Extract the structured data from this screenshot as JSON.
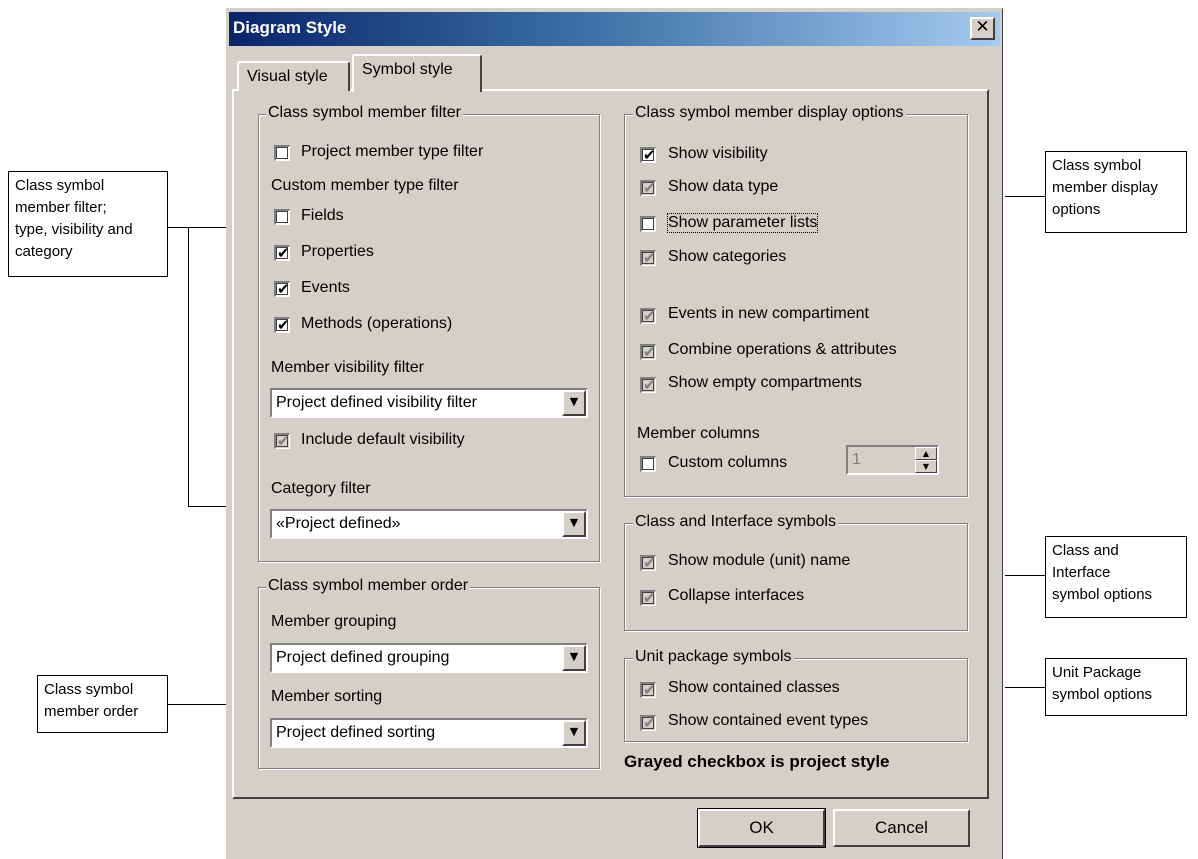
{
  "dialog": {
    "title": "Diagram Style",
    "close_glyph": "✕"
  },
  "tabs": [
    {
      "label": "Visual style",
      "active": false
    },
    {
      "label": "Symbol style",
      "active": true
    }
  ],
  "member_filter": {
    "title": "Class symbol member filter",
    "project_type_filter": {
      "label": "Project member type filter",
      "checked": false
    },
    "custom_label": "Custom member type filter",
    "fields": {
      "label": "Fields",
      "checked": false
    },
    "properties": {
      "label": "Properties",
      "checked": true
    },
    "events": {
      "label": "Events",
      "checked": true
    },
    "methods": {
      "label": "Methods (operations)",
      "checked": true
    },
    "visibility_label": "Member visibility filter",
    "visibility_value": "Project defined visibility filter",
    "include_default": {
      "label": "Include default visibility",
      "checked": true,
      "grayed": true
    },
    "category_label": "Category filter",
    "category_value": "«Project defined»"
  },
  "member_order": {
    "title": "Class symbol member order",
    "grouping_label": "Member grouping",
    "grouping_value": "Project defined grouping",
    "sorting_label": "Member sorting",
    "sorting_value": "Project defined sorting"
  },
  "display_options": {
    "title": "Class symbol member display options",
    "show_visibility": {
      "label": "Show visibility",
      "checked": true
    },
    "show_data_type": {
      "label": "Show data type",
      "checked": true,
      "grayed": true
    },
    "show_param_lists": {
      "label": "Show parameter lists",
      "checked": false
    },
    "show_categories": {
      "label": "Show categories",
      "checked": true,
      "grayed": true
    },
    "events_new_comp": {
      "label": "Events in new compartiment",
      "checked": true,
      "grayed": true
    },
    "combine_ops": {
      "label": "Combine operations & attributes",
      "checked": true,
      "grayed": true
    },
    "show_empty": {
      "label": "Show empty compartments",
      "checked": true,
      "grayed": true
    },
    "columns_label": "Member columns",
    "custom_columns": {
      "label": "Custom columns",
      "checked": false
    },
    "columns_value": "1"
  },
  "class_interface": {
    "title": "Class and Interface symbols",
    "show_module": {
      "label": "Show module (unit) name",
      "checked": true,
      "grayed": true
    },
    "collapse": {
      "label": "Collapse interfaces",
      "checked": true,
      "grayed": true
    }
  },
  "unit_package": {
    "title": "Unit package symbols",
    "contained_classes": {
      "label": "Show contained classes",
      "checked": true,
      "grayed": true
    },
    "contained_events": {
      "label": "Show contained event types",
      "checked": true,
      "grayed": true
    }
  },
  "note": "Grayed checkbox is project style",
  "buttons": {
    "ok": "OK",
    "cancel": "Cancel"
  },
  "check_glyph": "✔",
  "callouts": {
    "filter": [
      "Class symbol",
      "member filter;",
      "type, visibility and",
      "category"
    ],
    "order": [
      "Class symbol",
      "member order"
    ],
    "display": [
      "Class symbol",
      "member display",
      "options"
    ],
    "class_iface": [
      "Class and",
      "Interface",
      "symbol options"
    ],
    "unit_pkg": [
      "Unit Package",
      "symbol options"
    ]
  }
}
